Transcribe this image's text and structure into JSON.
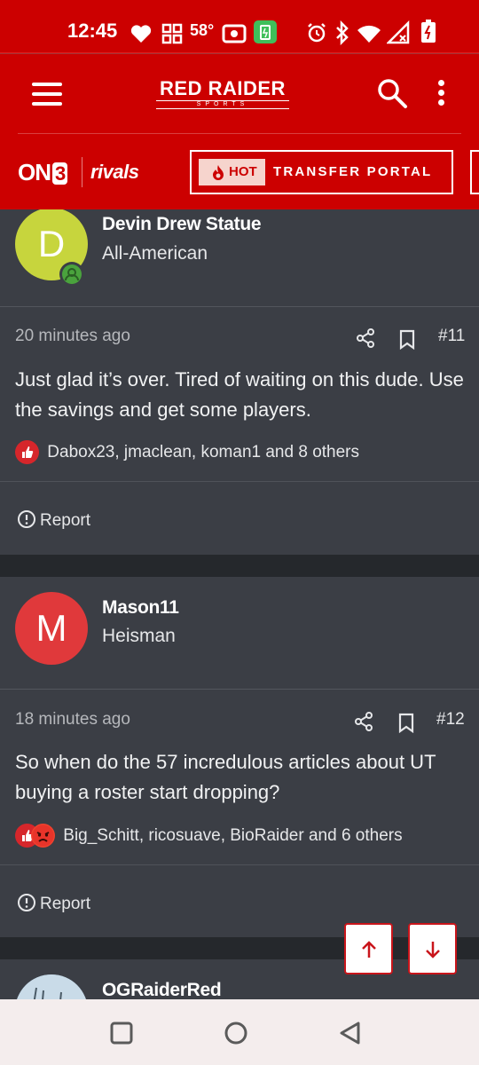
{
  "status_bar": {
    "time": "12:45",
    "temperature": "58°"
  },
  "header": {
    "logo_main": "RED RAIDER",
    "logo_sub": "SPORTS"
  },
  "subbar": {
    "on3_text": "ON",
    "on3_number": "3",
    "rivals_text": "rivals",
    "hot_label": "HOT",
    "portal_label": "TRANSFER PORTAL"
  },
  "posts": [
    {
      "username": "Devin Drew Statue",
      "user_title": "All-American",
      "avatar_letter": "D",
      "avatar_color": "#c7d53d",
      "time_ago": "20 minutes ago",
      "post_number": "#11",
      "body": "Just glad it’s over. Tired of waiting on this dude. Use the savings and get some players.",
      "reactions": "Dabox23, jmaclean, koman1 and 8 others",
      "report_label": "Report"
    },
    {
      "username": "Mason11",
      "user_title": "Heisman",
      "avatar_letter": "M",
      "avatar_color": "#e0393b",
      "time_ago": "18 minutes ago",
      "post_number": "#12",
      "body": "So when do the 57 incredulous articles about UT buying a roster start dropping?",
      "reactions": "Big_Schitt, ricosuave, BioRaider and 6 others",
      "report_label": "Report"
    },
    {
      "username": "OGRaiderRed"
    }
  ],
  "colors": {
    "brand_red": "#cc0000",
    "post_bg": "#3b3e45",
    "page_bg": "#25282c"
  }
}
